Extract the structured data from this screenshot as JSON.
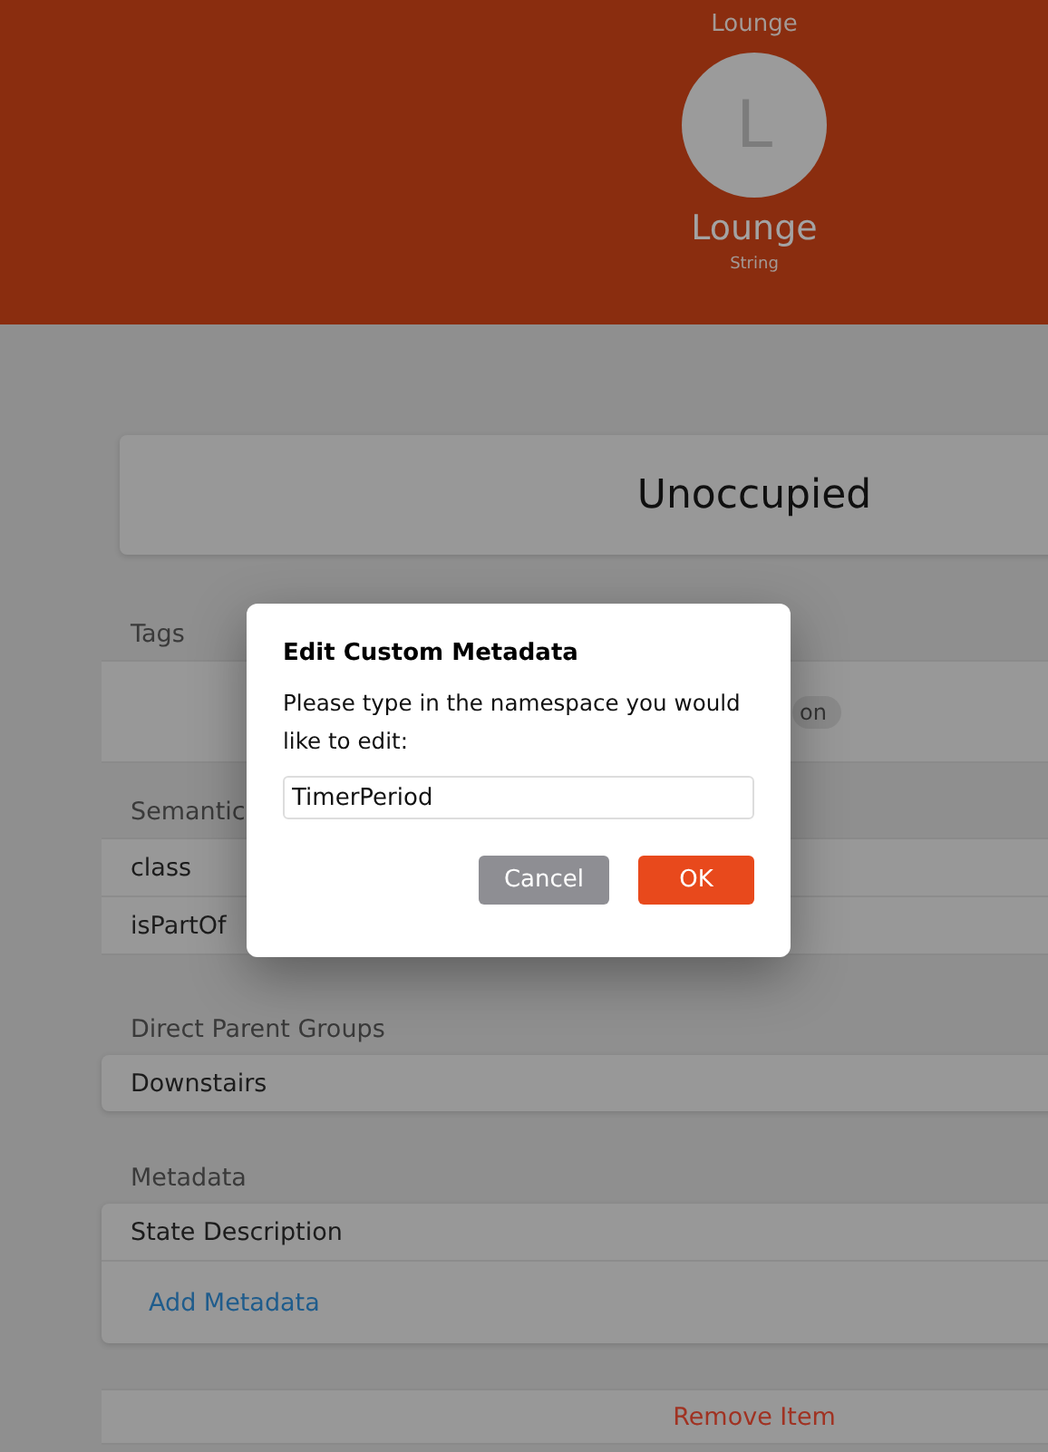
{
  "header": {
    "breadcrumb": "Lounge",
    "avatar_letter": "L",
    "title": "Lounge",
    "subtitle": "String"
  },
  "state": "Unoccupied",
  "tags": {
    "heading": "Tags",
    "items": [
      {
        "label": "on"
      }
    ]
  },
  "semantic": {
    "heading": "Semantic",
    "rows": [
      {
        "label": "class"
      },
      {
        "label": "isPartOf"
      }
    ]
  },
  "parent_groups": {
    "heading": "Direct Parent Groups",
    "items": [
      {
        "label": "Downstairs"
      }
    ]
  },
  "metadata": {
    "heading": "Metadata",
    "items": [
      {
        "label": "State Description"
      }
    ],
    "add_link": "Add Metadata"
  },
  "remove_button": "Remove Item",
  "dialog": {
    "title": "Edit Custom Metadata",
    "message": "Please type in the namespace you would like to edit:",
    "input_value": "TimerPeriod",
    "buttons": [
      {
        "label": "Cancel",
        "kind": "secondary"
      },
      {
        "label": "OK",
        "kind": "primary"
      }
    ]
  }
}
